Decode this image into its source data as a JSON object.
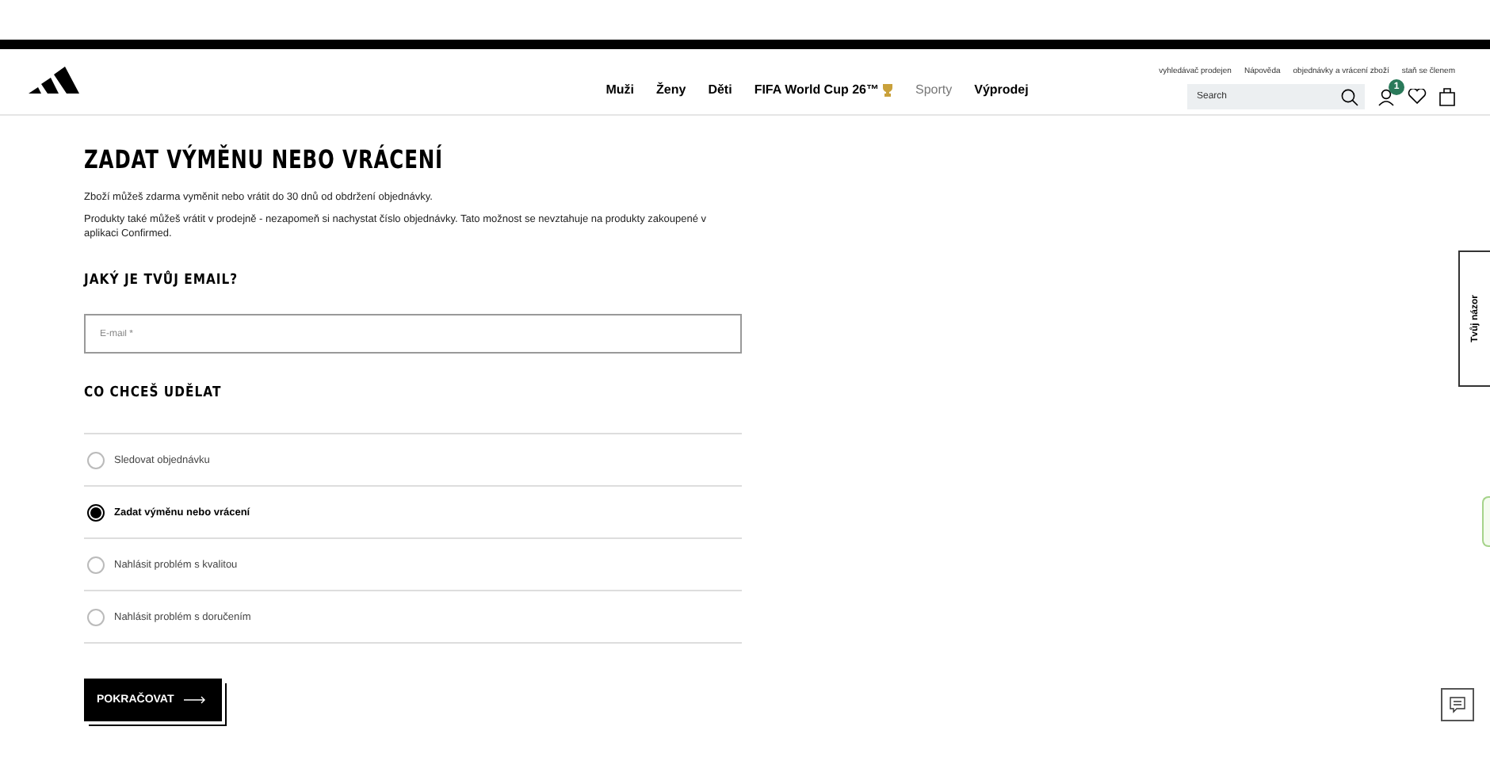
{
  "utility_links": [
    "vyhledávač prodejen",
    "Nápověda",
    "objednávky a vrácení zboží",
    "staň se členem"
  ],
  "nav": [
    {
      "label": "Muži",
      "bold": true
    },
    {
      "label": "Ženy",
      "bold": true
    },
    {
      "label": "Děti",
      "bold": true
    },
    {
      "label": "FIFA World Cup 26™",
      "bold": true,
      "trophy": true
    },
    {
      "label": "Sporty",
      "bold": false
    },
    {
      "label": "Výprodej",
      "bold": true
    }
  ],
  "search": {
    "placeholder": "Search"
  },
  "account_badge": "1",
  "title": "ZADAT VÝMĚNU NEBO VRÁCENÍ",
  "paragraphs": [
    "Zboží můžeš zdarma vyměnit nebo vrátit do 30 dnů od obdržení objednávky.",
    "Produkty také můžeš vrátit v prodejně - nezapomeň si nachystat číslo objednávky. Tato možnost se nevztahuje na produkty zakoupené v aplikaci Confirmed."
  ],
  "email_heading": "JAKÝ JE TVŮJ EMAIL?",
  "email_field": {
    "placeholder": "E-mail *"
  },
  "options_heading": "CO CHCEŠ UDĚLAT",
  "options": [
    {
      "label": "Sledovat objednávku",
      "selected": false
    },
    {
      "label": "Zadat výměnu nebo vrácení",
      "selected": true
    },
    {
      "label": "Nahlásit problém s kvalitou",
      "selected": false
    },
    {
      "label": "Nahlásit problém s doručením",
      "selected": false
    }
  ],
  "continue_button": "POKRAČOVAT",
  "feedback_tab": "Tvůj názor"
}
